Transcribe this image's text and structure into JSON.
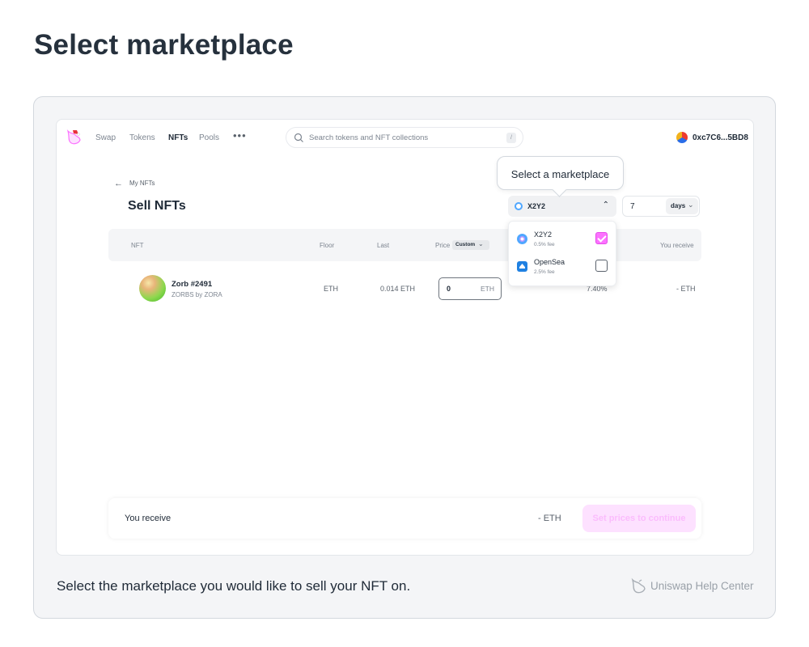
{
  "page_title": "Select marketplace",
  "nav": {
    "items": [
      {
        "label": "Swap",
        "active": false
      },
      {
        "label": "Tokens",
        "active": false
      },
      {
        "label": "NFTs",
        "active": true
      },
      {
        "label": "Pools",
        "active": false
      }
    ],
    "more": "•••",
    "search_placeholder": "Search tokens and NFT collections",
    "search_shortcut": "/",
    "account": "0xc7C6...5BD8"
  },
  "header": {
    "back_label": "My NFTs",
    "title": "Sell NFTs"
  },
  "marketplace_select": {
    "selected": "X2Y2",
    "tooltip": "Select a marketplace"
  },
  "duration": {
    "value": "7",
    "unit": "days"
  },
  "table": {
    "headers": {
      "nft": "NFT",
      "floor": "Floor",
      "last": "Last",
      "price": "Price",
      "custom": "Custom",
      "you_receive": "You receive"
    },
    "row": {
      "name": "Zorb #2491",
      "collection": "ZORBS by ZORA",
      "floor": "ETH",
      "last": "0.014 ETH",
      "price_value": "0",
      "price_unit": "ETH",
      "fee": "7.40%",
      "you_receive": "- ETH"
    }
  },
  "dropdown": {
    "options": [
      {
        "name": "X2Y2",
        "fee": "0.5% fee",
        "checked": true
      },
      {
        "name": "OpenSea",
        "fee": "2.5% fee",
        "checked": false
      }
    ]
  },
  "bottom_bar": {
    "label": "You receive",
    "amount": "- ETH",
    "button": "Set prices to continue"
  },
  "caption": "Select the marketplace you would like to sell your NFT on.",
  "help_center": "Uniswap Help Center",
  "colors": {
    "accent_pink": "#fc72ff",
    "opensea_blue": "#2081e2",
    "x2y2_blue": "#4fa7ff"
  }
}
